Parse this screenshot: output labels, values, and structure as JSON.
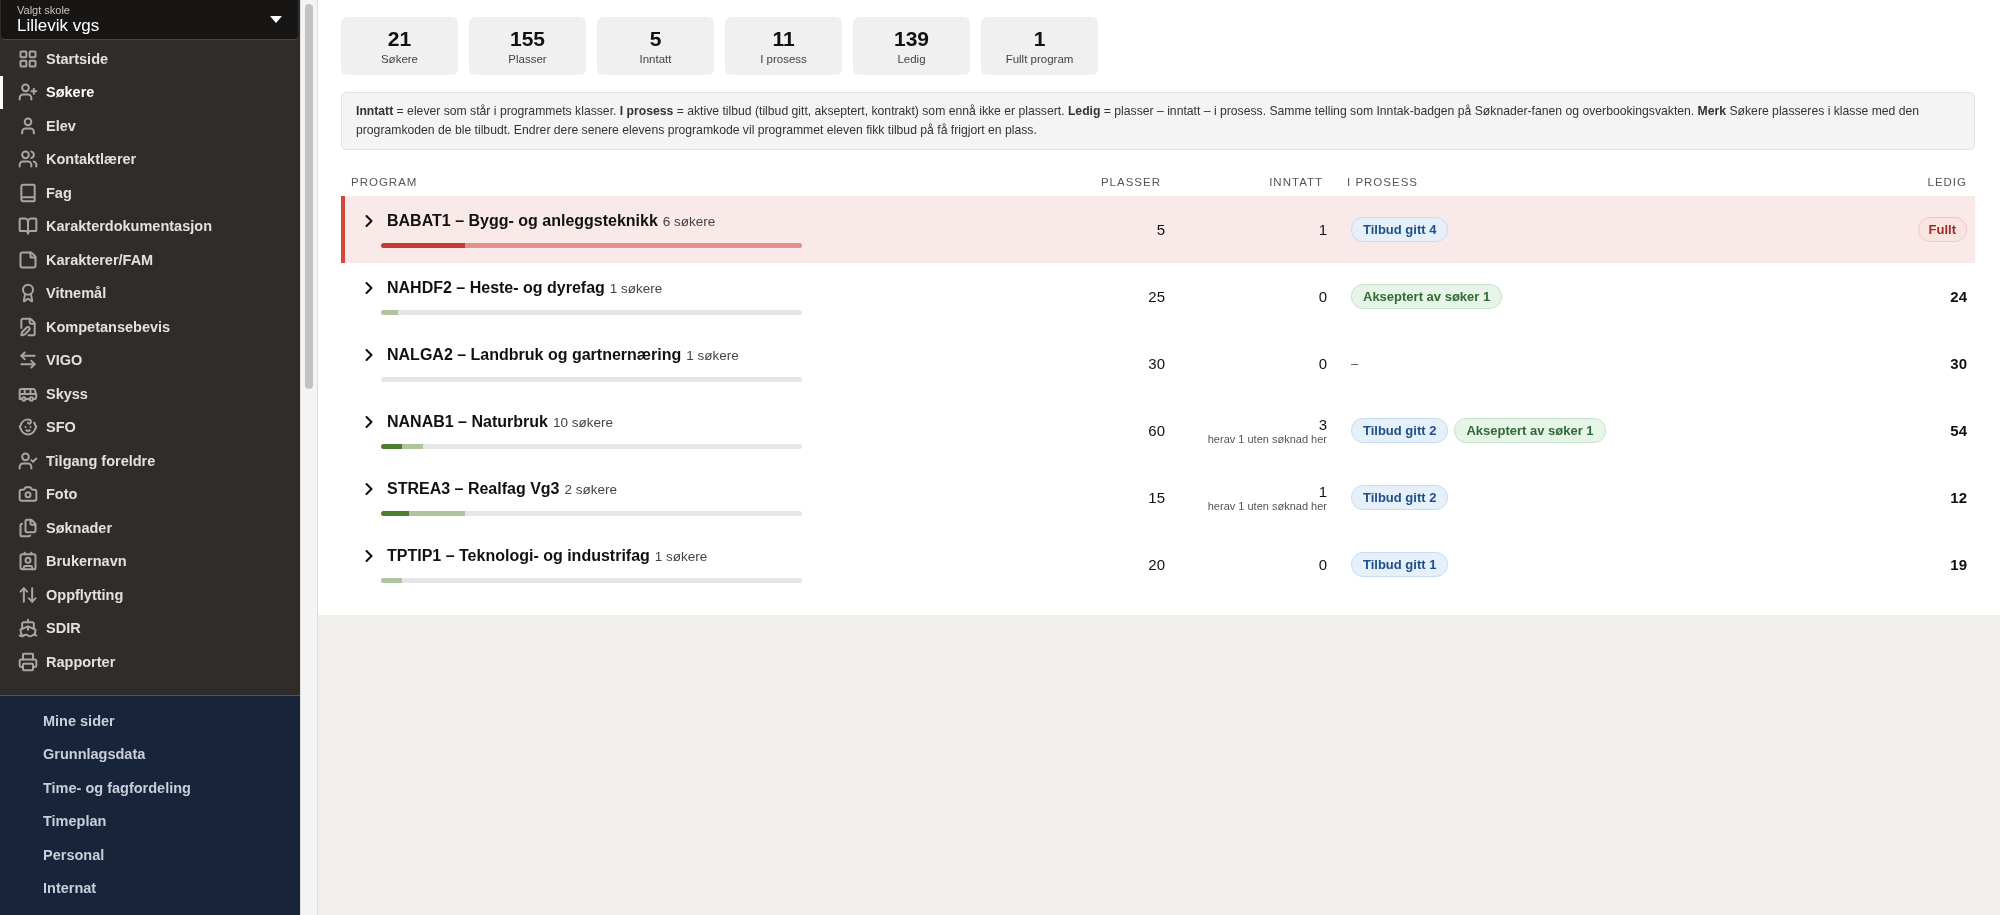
{
  "sidebar": {
    "school_select": {
      "label": "Valgt skole",
      "value": "Lillevik vgs"
    },
    "items": [
      {
        "label": "Startside",
        "selected": false
      },
      {
        "label": "Søkere",
        "selected": true
      },
      {
        "label": "Elev",
        "selected": false
      },
      {
        "label": "Kontaktlærer",
        "selected": false
      },
      {
        "label": "Fag",
        "selected": false
      },
      {
        "label": "Karakterdokumentasjon",
        "selected": false
      },
      {
        "label": "Karakterer/FAM",
        "selected": false
      },
      {
        "label": "Vitnemål",
        "selected": false
      },
      {
        "label": "Kompetansebevis",
        "selected": false
      },
      {
        "label": "VIGO",
        "selected": false
      },
      {
        "label": "Skyss",
        "selected": false
      },
      {
        "label": "SFO",
        "selected": false
      },
      {
        "label": "Tilgang foreldre",
        "selected": false
      },
      {
        "label": "Foto",
        "selected": false
      },
      {
        "label": "Søknader",
        "selected": false
      },
      {
        "label": "Brukernavn",
        "selected": false
      },
      {
        "label": "Oppflytting",
        "selected": false
      },
      {
        "label": "SDIR",
        "selected": false
      },
      {
        "label": "Rapporter",
        "selected": false
      }
    ],
    "secondary_items": [
      "Mine sider",
      "Grunnlagsdata",
      "Time- og fagfordeling",
      "Timeplan",
      "Personal",
      "Internat"
    ]
  },
  "stats": [
    {
      "value": "21",
      "label": "Søkere"
    },
    {
      "value": "155",
      "label": "Plasser"
    },
    {
      "value": "5",
      "label": "Inntatt"
    },
    {
      "value": "11",
      "label": "I prosess"
    },
    {
      "value": "139",
      "label": "Ledig"
    },
    {
      "value": "1",
      "label": "Fullt program"
    }
  ],
  "info": "**Inntatt** = elever som står i programmets klasser. **I prosess** = aktive tilbud (tilbud gitt, akseptert, kontrakt) som ennå ikke er plassert. **Ledig** = plasser – inntatt – i prosess. Samme telling som Inntak-badgen på Søknader-fanen og overbookingsvakten. **Merk** Søkere plasseres i klasse med den programkoden de ble tilbudt. Endrer dere senere elevens programkode vil programmet eleven fikk tilbud på få frigjort en plass.",
  "table": {
    "columns": [
      "PROGRAM",
      "PLASSER",
      "INNTATT",
      "I PROSESS",
      "LEDIG"
    ],
    "rows": [
      {
        "program": "BABAT1 – Bygg- og anleggsteknikk",
        "applicants": "6 søkere",
        "full": true,
        "bar": [
          {
            "kind": "admitted",
            "level": 0.2
          },
          {
            "kind": "pending",
            "level": 0.8
          }
        ],
        "plasser": "5",
        "inntatt": "1",
        "process": [
          {
            "kind": "offer",
            "label": "Tilbud gitt 4"
          }
        ],
        "ledig": "Fullt"
      },
      {
        "program": "NAHDF2 – Heste- og dyrefag",
        "applicants": "1 søkere",
        "full": false,
        "bar": [
          {
            "kind": "admitted",
            "level": 0
          },
          {
            "kind": "pending",
            "level": 0.04
          }
        ],
        "plasser": "25",
        "inntatt": "0",
        "process": [
          {
            "kind": "accepted",
            "label": "Akseptert av søker 1"
          }
        ],
        "ledig": "24"
      },
      {
        "program": "NALGA2 – Landbruk og gartnernæring",
        "applicants": "1 søkere",
        "full": false,
        "bar": [
          {
            "kind": "admitted",
            "level": 0
          },
          {
            "kind": "pending",
            "level": 0
          }
        ],
        "plasser": "30",
        "inntatt": "0",
        "process_empty": "–",
        "ledig": "30"
      },
      {
        "program": "NANAB1 – Naturbruk",
        "applicants": "10 søkere",
        "full": false,
        "bar": [
          {
            "kind": "admitted",
            "level": 0.05
          },
          {
            "kind": "pending",
            "level": 0.05
          }
        ],
        "plasser": "60",
        "inntatt": "3",
        "inntatt_note": "herav 1 uten søknad her",
        "process": [
          {
            "kind": "offer",
            "label": "Tilbud gitt 2"
          },
          {
            "kind": "accepted",
            "label": "Akseptert av søker 1"
          }
        ],
        "ledig": "54"
      },
      {
        "program": "STREA3 – Realfag Vg3",
        "applicants": "2 søkere",
        "full": false,
        "bar": [
          {
            "kind": "admitted",
            "level": 0.067
          },
          {
            "kind": "pending",
            "level": 0.133
          }
        ],
        "plasser": "15",
        "inntatt": "1",
        "inntatt_note": "herav 1 uten søknad her",
        "process": [
          {
            "kind": "offer",
            "label": "Tilbud gitt 2"
          }
        ],
        "ledig": "12"
      },
      {
        "program": "TPTIP1 – Teknologi- og industrifag",
        "applicants": "1 søkere",
        "full": false,
        "bar": [
          {
            "kind": "admitted",
            "level": 0
          },
          {
            "kind": "pending",
            "level": 0.05
          }
        ],
        "plasser": "20",
        "inntatt": "0",
        "process": [
          {
            "kind": "offer",
            "label": "Tilbud gitt 1"
          }
        ],
        "ledig": "19"
      }
    ]
  }
}
